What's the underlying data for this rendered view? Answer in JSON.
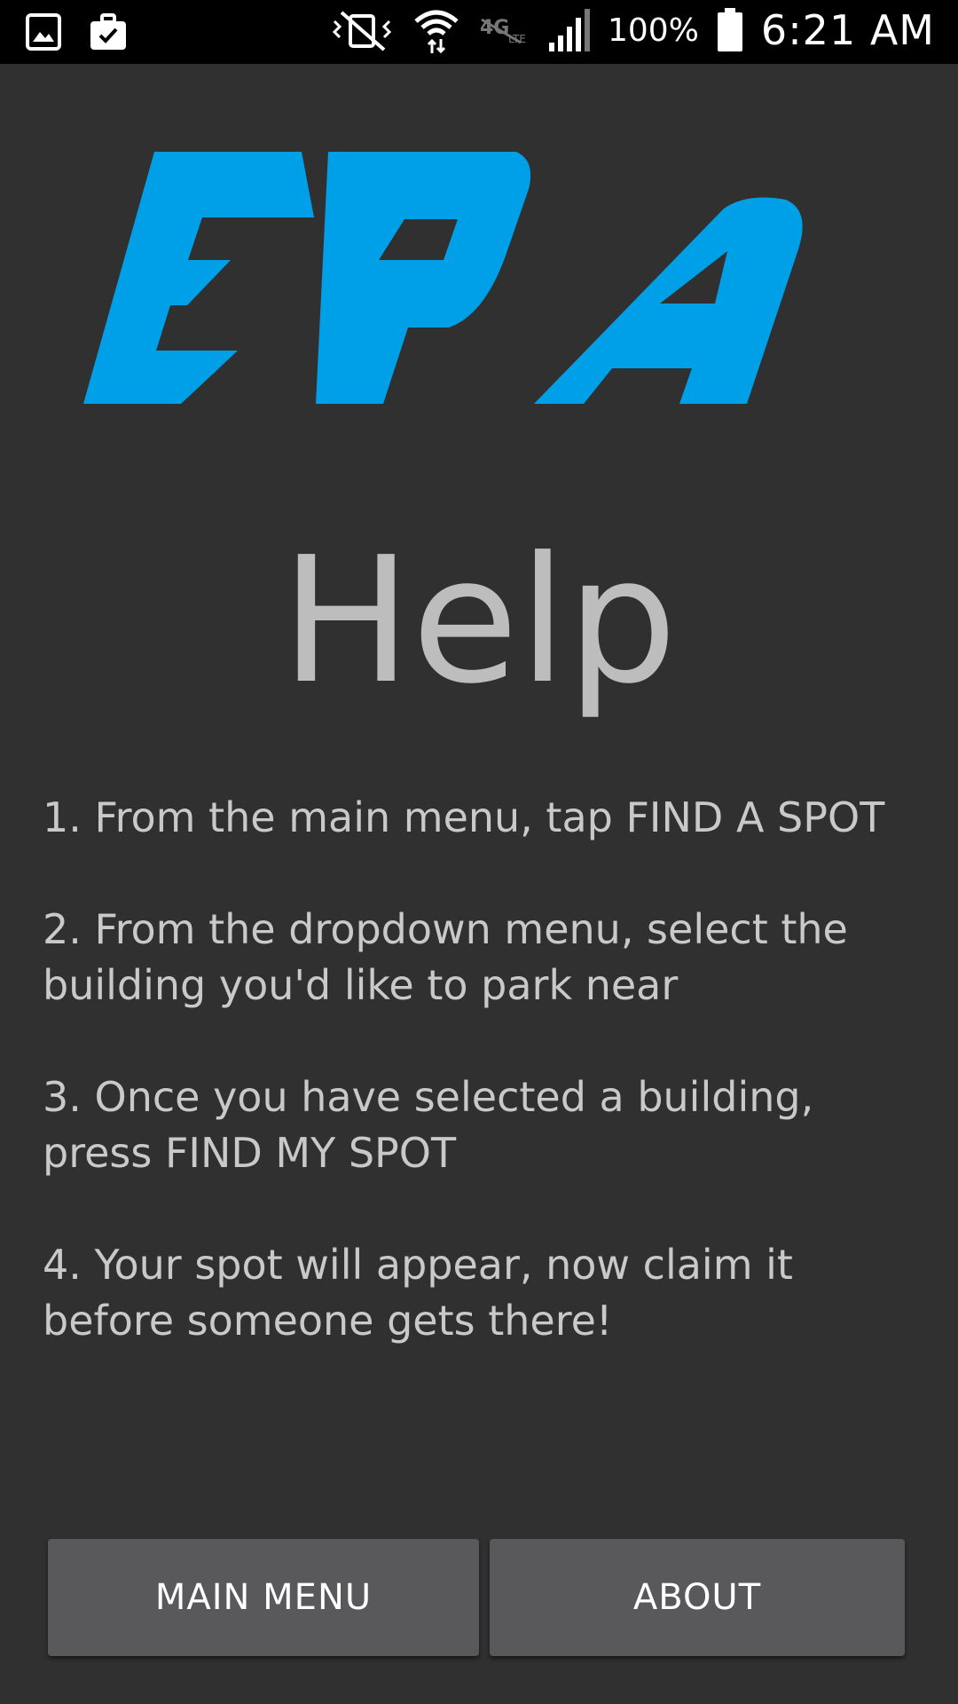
{
  "status_bar": {
    "battery_percent": "100%",
    "time": "6:21 AM",
    "icons": [
      "gallery-icon",
      "briefcase-icon",
      "vibrate-icon",
      "wifi-icon",
      "lte-icon",
      "signal-icon",
      "battery-icon"
    ]
  },
  "logo": {
    "text": "EPA",
    "color": "#00a0e9"
  },
  "page": {
    "title": "Help"
  },
  "steps": [
    "1. From the main menu, tap FIND A SPOT",
    "2. From the dropdown menu, select the building you'd like to park near",
    "3. Once you have selected a building, press FIND MY SPOT",
    "4. Your spot will appear, now claim it before someone gets there!"
  ],
  "buttons": {
    "main_menu": "MAIN MENU",
    "about": "ABOUT"
  },
  "colors": {
    "background": "#303030",
    "text": "#c9c9c9",
    "button": "#59595b",
    "accent": "#00a0e9"
  }
}
